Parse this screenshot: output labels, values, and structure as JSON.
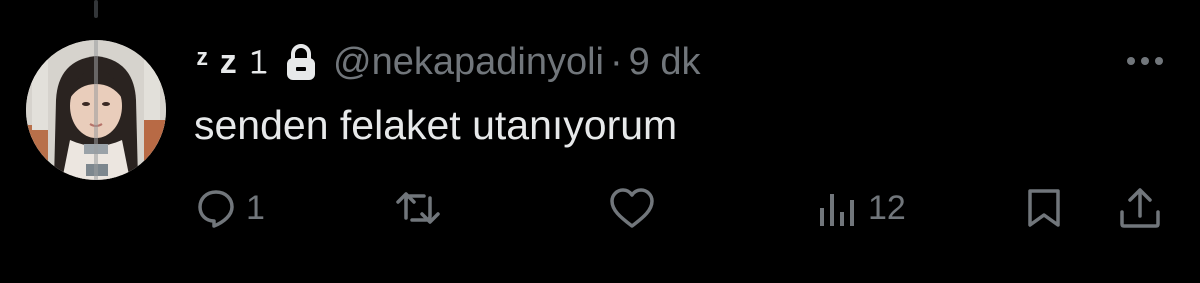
{
  "tweet": {
    "display_name": "ᶻ z 𝟷",
    "handle": "@nekapadinyoli",
    "separator": "·",
    "timestamp": "9 dk",
    "text": "senden felaket utanıyorum",
    "protected": true,
    "icons": {
      "more": "more-horizontal-icon",
      "lock": "lock-icon"
    }
  },
  "actions": {
    "reply_count": "1",
    "retweet_count": "",
    "like_count": "",
    "views_count": "12",
    "icons": [
      "reply-icon",
      "retweet-icon",
      "like-icon",
      "views-icon",
      "bookmark-icon",
      "share-icon"
    ]
  },
  "colors": {
    "background": "#000000",
    "text_primary": "#e7e9ea",
    "text_secondary": "#71767b",
    "thread_line": "#333639"
  }
}
